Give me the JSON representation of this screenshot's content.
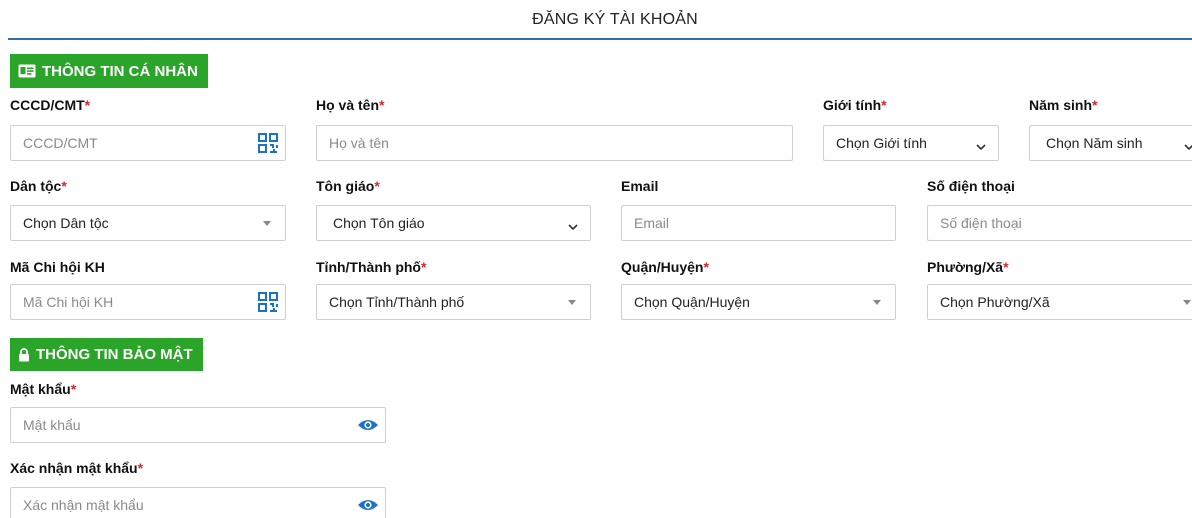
{
  "header": {
    "title": "ĐĂNG KÝ TÀI KHOẢN"
  },
  "sections": {
    "personal": "THÔNG TIN CÁ NHÂN",
    "security": "THÔNG TIN BẢO MẬT"
  },
  "required_mark": "*",
  "fields": {
    "cccd": {
      "label": "CCCD/CMT",
      "placeholder": "CCCD/CMT"
    },
    "fullname": {
      "label": "Họ và tên",
      "placeholder": "Họ và tên"
    },
    "gender": {
      "label": "Giới tính",
      "selected": "Chọn Giới tính"
    },
    "birthyear": {
      "label": "Năm sinh",
      "selected": "Chọn Năm sinh"
    },
    "ethnicity": {
      "label": "Dân tộc",
      "selected": "Chọn Dân tộc"
    },
    "religion": {
      "label": "Tôn giáo",
      "selected": "Chọn Tôn giáo"
    },
    "email": {
      "label": "Email",
      "placeholder": "Email"
    },
    "phone": {
      "label": "Số điện thoại",
      "placeholder": "Số điện thoại"
    },
    "branch": {
      "label": "Mã Chi hội KH",
      "placeholder": "Mã Chi hội KH"
    },
    "province": {
      "label": "Tỉnh/Thành phố",
      "selected": "Chọn Tỉnh/Thành phố"
    },
    "district": {
      "label": "Quận/Huyện",
      "selected": "Chọn Quận/Huyện"
    },
    "ward": {
      "label": "Phường/Xã",
      "selected": "Chọn Phường/Xã"
    },
    "password": {
      "label": "Mật khẩu",
      "placeholder": "Mật khẩu"
    },
    "confirm_password": {
      "label": "Xác nhận mật khẩu",
      "placeholder": "Xác nhận mật khẩu"
    }
  },
  "icons": {
    "id_card": "id-card-icon",
    "lock": "lock-icon",
    "qr": "qr-code-icon",
    "eye": "eye-icon",
    "chevron": "chevron-down-icon",
    "caret": "caret-down-icon"
  },
  "colors": {
    "accent_green": "#2aa52a",
    "title_rule_blue": "#2f6db5",
    "required_red": "#d9232d",
    "icon_blue": "#1a73c9"
  }
}
